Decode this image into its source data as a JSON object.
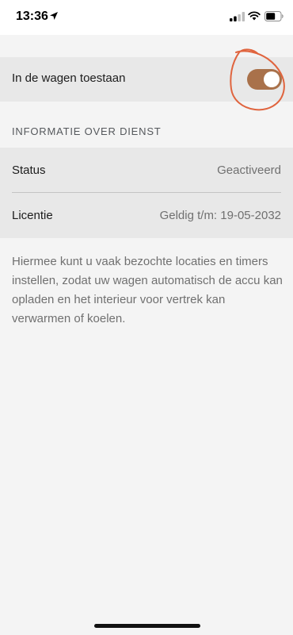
{
  "status_bar": {
    "time": "13:36",
    "icons": [
      "location-arrow-icon",
      "cellular-signal-icon",
      "wifi-icon",
      "battery-icon"
    ]
  },
  "toggle": {
    "label": "In de wagen toestaan",
    "enabled": true,
    "accent_color": "#a9714a"
  },
  "annotation_color": "#e0643e",
  "section": {
    "title": "INFORMATIE OVER DIENST",
    "rows": [
      {
        "label": "Status",
        "value": "Geactiveerd"
      },
      {
        "label": "Licentie",
        "value": "Geldig t/m: 19-05-2032"
      }
    ]
  },
  "description": "Hiermee kunt u vaak bezochte locaties en timers instellen, zodat uw wagen automatisch de accu kan opladen en het interieur voor vertrek kan verwarmen of koelen."
}
